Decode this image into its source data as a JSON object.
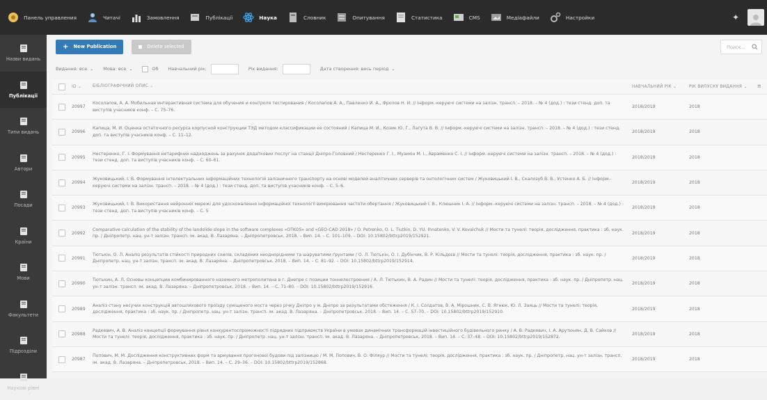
{
  "topnav": [
    {
      "label": "Панель управления",
      "icon": "dashboard-icon"
    },
    {
      "label": "Читачі",
      "icon": "readers-icon"
    },
    {
      "label": "Замовлення",
      "icon": "orders-chart-icon"
    },
    {
      "label": "Публікації",
      "icon": "publications-icon"
    },
    {
      "label": "Наука",
      "icon": "atom-icon",
      "active": true
    },
    {
      "label": "Словник",
      "icon": "dictionary-icon"
    },
    {
      "label": "Опитування",
      "icon": "survey-icon"
    },
    {
      "label": "Статистика",
      "icon": "statistics-icon"
    },
    {
      "label": "CMS",
      "icon": "cms-icon"
    },
    {
      "label": "Медіафайли",
      "icon": "media-icon"
    },
    {
      "label": "Настройки",
      "icon": "settings-gears-icon"
    }
  ],
  "sidebar": [
    {
      "label": "Назви видань"
    },
    {
      "label": "Публікації",
      "active": true
    },
    {
      "label": "Типи видань"
    },
    {
      "label": "Автори"
    },
    {
      "label": "Посади"
    },
    {
      "label": "Країни"
    },
    {
      "label": "Мови"
    },
    {
      "label": "Факультети"
    },
    {
      "label": "Підрозділи"
    },
    {
      "label": "Наукові рівні"
    }
  ],
  "toolbar": {
    "new_label": "New Publication",
    "delete_label": "Delete selected",
    "search_placeholder": "Поиск..."
  },
  "filters": {
    "edition": "Видання: все",
    "language": "Мова: все",
    "ob": "Об",
    "academic_year": "Навчальний рік:",
    "year_published": "Рік видання:",
    "created": "Дата створення: весь період"
  },
  "table": {
    "headers": {
      "id": "ID",
      "desc": "БІБЛІОГРАФІЧНИЙ ОПИС",
      "academic_year": "НАВЧАЛЬНИЙ РІК",
      "year_published": "РІК ВИПУСКУ ВИДАННЯ"
    },
    "rows": [
      {
        "id": "20997",
        "desc": "Косолапов, А. А. Мобильная интерактивная система для обучения и контроля тестирования / Косолапов А. А., Павленко И. А., Фролов Н. И. // Інформ.-керуючі системи на залізн. трансп. – 2018. – № 4 (дод.) : тези стенд. доп. та виступів учасників конф. – С. 75–76.",
        "academic_year": "2018/2019",
        "year_published": "2018"
      },
      {
        "id": "20996",
        "desc": "Капица, М. И. Оценка остаточного ресурса корпусной конструкции ТЭД методом классификации ее состояний / Капица М. И., Козик Ю. Г., Лагута В. В. // Інформ.-керуючі системи на залізн. трансп. – 2018. – № 4 (дод.) : тези стенд. доп. та виступів учасників конф. – С. 11–12.",
        "academic_year": "2018/2019",
        "year_published": "2018"
      },
      {
        "id": "20995",
        "desc": "Нестеренко, Г. І. Формування нетарифних надходжень за рахунок додаткових послуг на станції Дніпро-Головний / Нестеренко Г. І., Музикін М. І., Авраменко С. І. // Інформ.-керуючі системи на залізн. трансп. – 2018. – № 4 (дод.) : тези стенд. доп. та виступів учасників конф. – С. 60–61.",
        "academic_year": "2018/2019",
        "year_published": "2018"
      },
      {
        "id": "20994",
        "desc": "Жуковицький, І. В. Формування інтелектуальних інформаційних технологій залізничного транспорту на основі моделей аналітичних серверів та онтологічних систем / Жуковицький І. В., Скалозуб В. В., Устенко А. Б. // Інформ.-керуючі системи на залізн. трансп. – 2018. – № 4 (дод.) : тези стенд. доп. та виступів учасників конф. – С. 5–6.",
        "academic_year": "2018/2019",
        "year_published": "2018"
      },
      {
        "id": "20993",
        "desc": "Жуковицький, І. В. Використання нейронної мережі для удосконалення інформаційної технології вимірювання частоти обертання / Жуковицький І. В., Клюшник І. А. // Інформ.-керуючі системи на залізн. трансп. – 2018. – № 4 (дод.) : тези стенд. доп. та виступів учасників конф. – С. 5",
        "academic_year": "2018/2019",
        "year_published": "2018"
      },
      {
        "id": "20992",
        "desc": "Comparative calculation of the stability of the landslide slope in the software complexes «OTKOS» and «GEO-CAD 2018» / O. Petrenko, O. L. Tiutkin, D. YU. Ihnatenko, V. V. Kovalchuk // Мости та тунелі: теорія, дослідження, практика : зб. наук. пр. / Дніпропетр. нац. ун-т залізн. трансп. ім. акад. В. Лазаряна. – Дніпропетровськ, 2018. – Вип. 14. – С. 101–109. – DOI: 10.15802/bttrp2019/152921.",
        "academic_year": "2018/2019",
        "year_published": "2018"
      },
      {
        "id": "20991",
        "desc": "Тютькін, О. Л. Аналіз результатів стійкості природних схилів, складених неоднорідними та шаруватими ґрунтами / О. Л. Тютькін, О. І. Дубінчик, В. Р. Кільдєєв // Мости та тунелі: теорія, дослідження, практика : зб. наук. пр. / Дніпропетр. нац. ун-т залізн. трансп. ім. акад. В. Лазаряна. – Дніпропетровськ, 2018. – Вип. 14. – С. 81–92. – DOI: 10.15802/bttrp2019/152914.",
        "academic_year": "2018/2019",
        "year_published": "2018"
      },
      {
        "id": "20990",
        "desc": "Тютькин, А. Л. Основы концепции комбинированного наземного метрополитена в г. Днепре с позиции тоннелестроения / А. Л. Тютькин, В. А. Радин // Мости та тунелі: теорія, дослідження, практика : зб. наук. пр. / Дніпропетр. нац. ун-т залізн. трансп. ім. акад. В. Лазаряна. – Дніпропетровськ, 2018. – Вип. 14. – С. 71–80. – DOI: 10.15802/bttrp2019/152916.",
        "academic_year": "2018/2019",
        "year_published": "2018"
      },
      {
        "id": "20989",
        "desc": "Аналіз стану несучих конструкцій автошляхового проїзду суміщеного моста через річку Дніпро у м. Дніпро за результатами обстеження / К. І. Солдатов, В. А. Мірошник, С. В. Ягнюк, Ю. Л. Заяць // Мости та тунелі: теорія, дослідження, практика : зб. наук. пр. / Дніпропетр. нац. ун-т залізн. трансп. ім. акад. В. Лазаряна. – Дніпропетровськ, 2018. – Вип. 14. – С. 57–70. – DOI: 10.15802/bttrp2019/152910.",
        "academic_year": "2018/2019",
        "year_published": "2018"
      },
      {
        "id": "20988",
        "desc": "Радкевич, А. В. Аналіз концепції формування рівня конкурентоспроможності підрядних підприємств України в умовах динамічних трансформацій інвестиційного будівельного ринку / А. В. Радкевич, І. А. Арутюнян, Д. В. Сайков // Мости та тунелі: теорія, дослідження, практика : зб. наук. пр. / Дніпропетр. нац. ун-т залізн. трансп. ім. акад. В. Лазаряна. – Дніпропетровськ, 2018. – Вип. 14. – С. 37–48. – DOI: 10.15802/bttrp2019/152872.",
        "academic_year": "2018/2019",
        "year_published": "2018"
      },
      {
        "id": "20987",
        "desc": "Попович, М. М. Дослідження конструктивних форм та армування прогонової будови під залізницю / М. М. Попович, В. О. Філяур // Мости та тунелі: теорія, дослідження, практика : зб. наук. пр. / Дніпропетр. нац. ун-т залізн. трансп. ім. акад. В. Лазаряна. – Дніпропетровськ, 2018. – Вип. 14. – С. 29–36. – DOI: 10.15802/bttrp2019/152868.",
        "academic_year": "2018/2019",
        "year_published": "2018"
      }
    ]
  }
}
